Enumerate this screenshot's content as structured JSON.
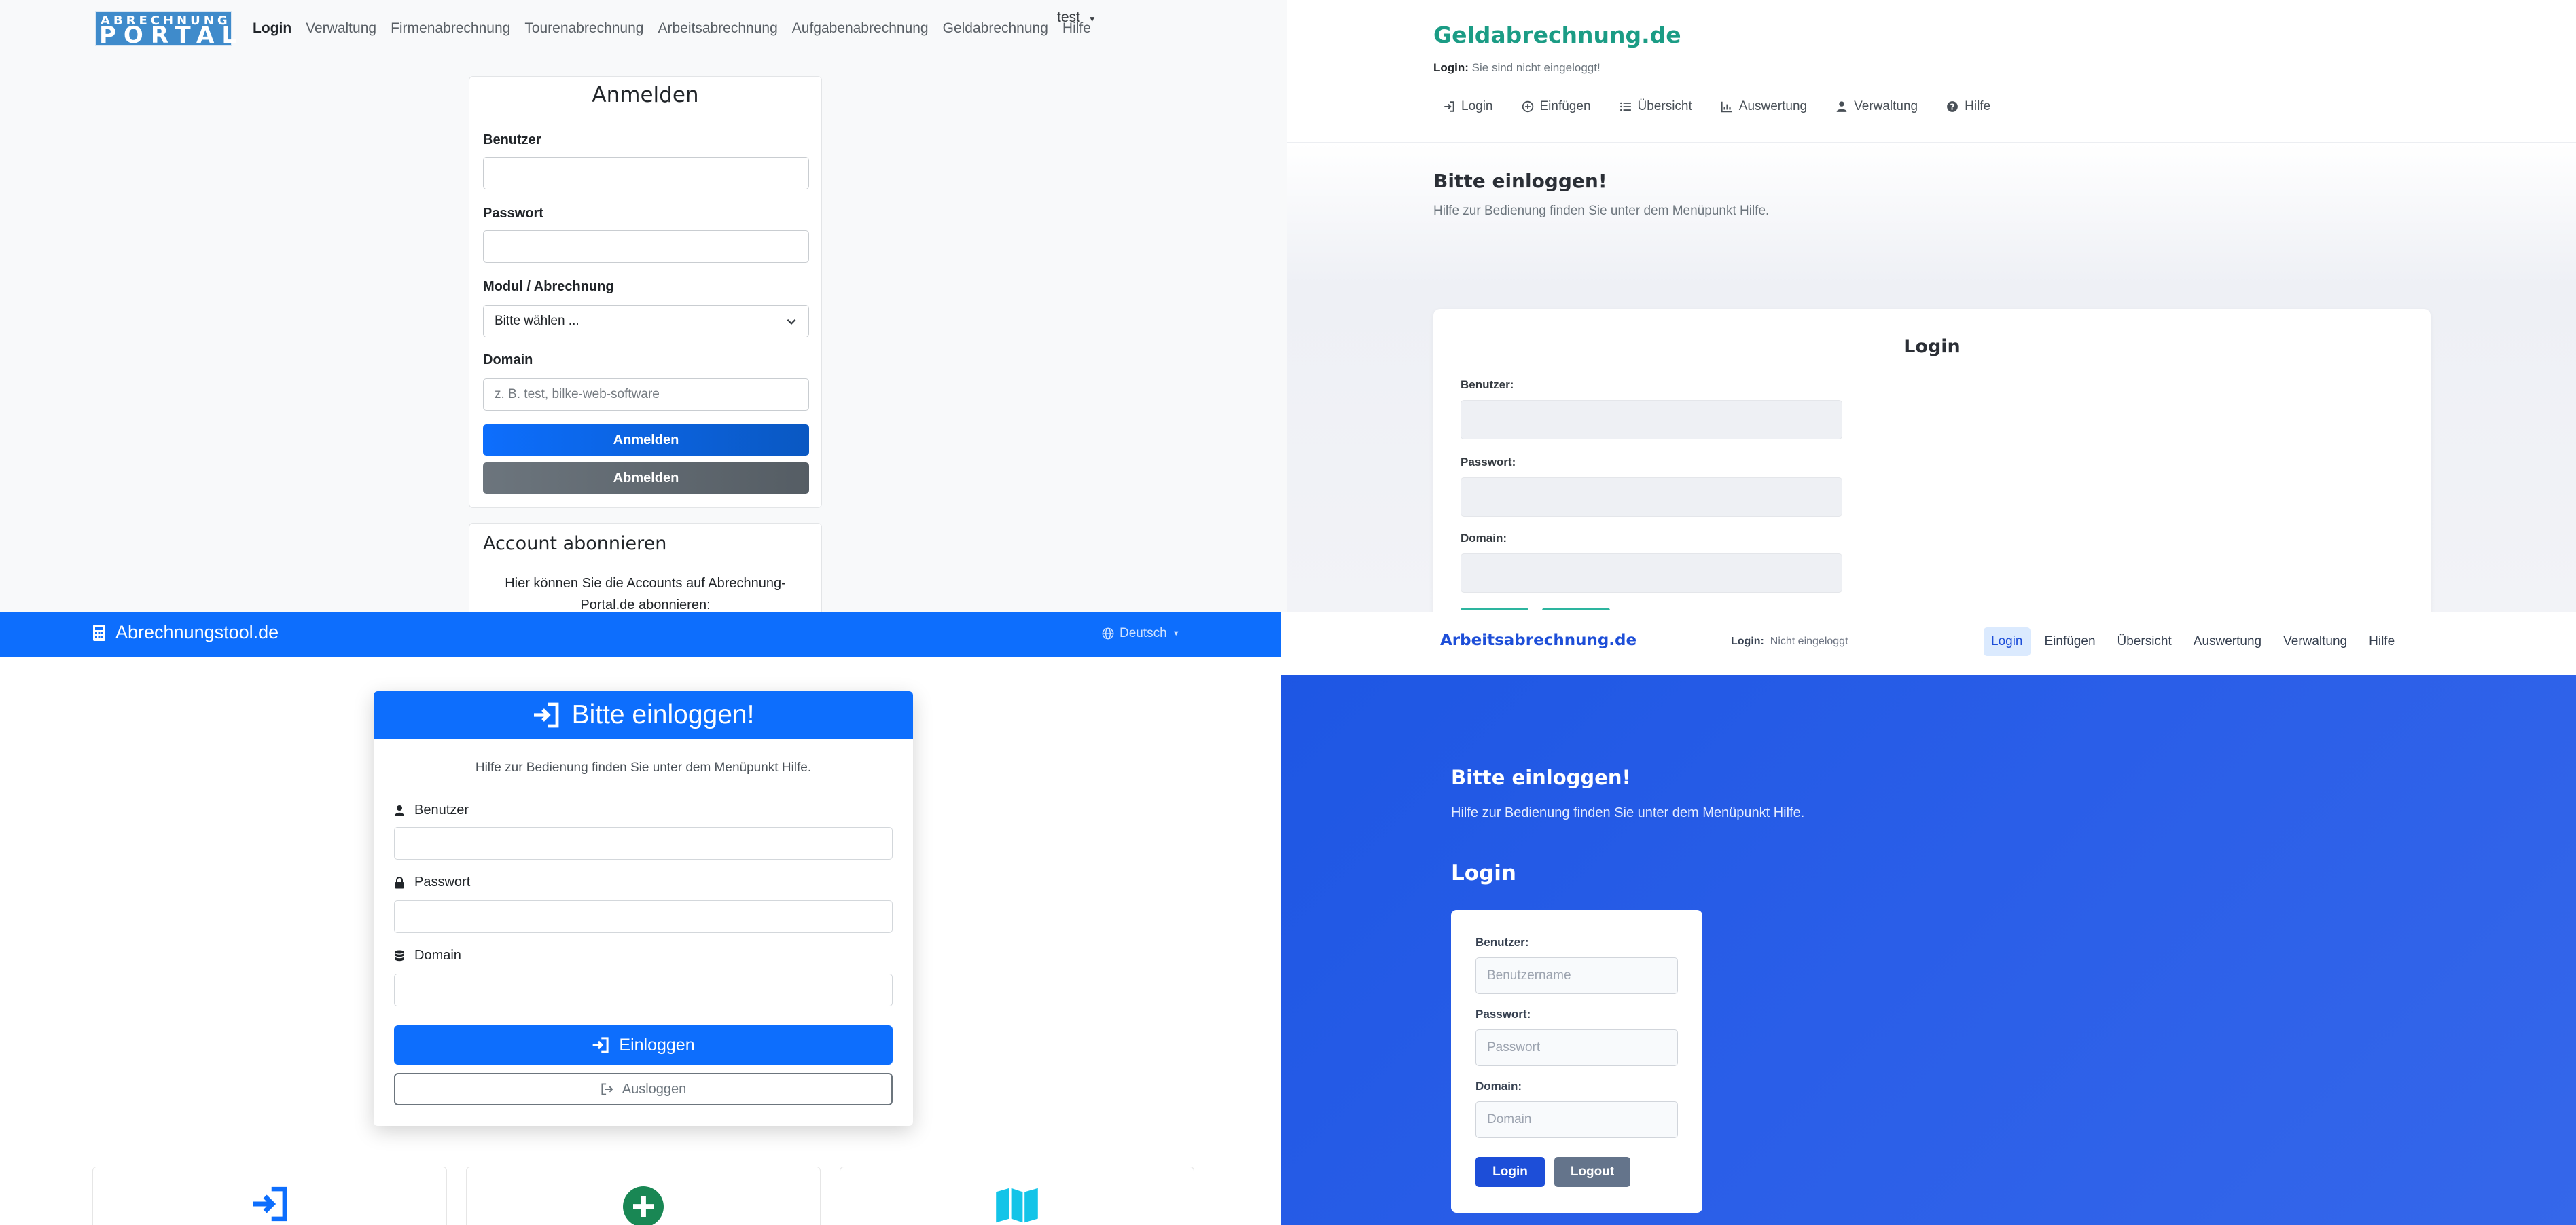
{
  "portal": {
    "logo_top": "ABRECHNUNG",
    "logo_bottom": "PORTAL",
    "nav": [
      "Login",
      "Verwaltung",
      "Firmenabrechnung",
      "Tourenabrechnung",
      "Arbeitsabrechnung",
      "Aufgabenabrechnung",
      "Geldabrechnung",
      "Hilfe"
    ],
    "user_menu": "test",
    "login_card": {
      "title": "Anmelden",
      "user_label": "Benutzer",
      "password_label": "Passwort",
      "module_label": "Modul / Abrechnung",
      "module_selected": "Bitte wählen ...",
      "domain_label": "Domain",
      "domain_placeholder": "z. B. test, bilke-web-software",
      "login_button": "Anmelden",
      "logout_button": "Abmelden"
    },
    "subscribe_card": {
      "title": "Account abonnieren",
      "text": "Hier können Sie die Accounts auf Abrechnung-Portal.de abonnieren:"
    }
  },
  "geld": {
    "brand": "Geldabrechnung.de",
    "status_label": "Login:",
    "status_text": "Sie sind nicht eingeloggt!",
    "nav": [
      "Login",
      "Einfügen",
      "Übersicht",
      "Auswertung",
      "Verwaltung",
      "Hilfe"
    ],
    "heading": "Bitte einloggen!",
    "subheading": "Hilfe zur Bedienung finden Sie unter dem Menüpunkt Hilfe.",
    "card": {
      "title": "Login",
      "user_label": "Benutzer:",
      "password_label": "Passwort:",
      "domain_label": "Domain:"
    }
  },
  "tool": {
    "brand": "Abrechnungstool.de",
    "language": "Deutsch",
    "card": {
      "title": "Bitte einloggen!",
      "help": "Hilfe zur Bedienung finden Sie unter dem Menüpunkt Hilfe.",
      "user_label": "Benutzer",
      "password_label": "Passwort",
      "domain_label": "Domain",
      "login_button": "Einloggen",
      "logout_button": "Ausloggen"
    }
  },
  "arbeit": {
    "brand": "Arbeitsabrechnung.de",
    "status_label": "Login:",
    "status_text": "Nicht eingeloggt",
    "nav": [
      "Login",
      "Einfügen",
      "Übersicht",
      "Auswertung",
      "Verwaltung",
      "Hilfe"
    ],
    "heading": "Bitte einloggen!",
    "subheading": "Hilfe zur Bedienung finden Sie unter dem Menüpunkt Hilfe.",
    "section_title": "Login",
    "card": {
      "user_label": "Benutzer:",
      "user_placeholder": "Benutzername",
      "password_label": "Passwort:",
      "password_placeholder": "Passwort",
      "domain_label": "Domain:",
      "domain_placeholder": "Domain",
      "login_button": "Login",
      "logout_button": "Logout"
    }
  },
  "colors": {
    "portal_primary": "#0d6efd",
    "geld_brand": "#1b9c85",
    "tool_primary": "#0d6efd",
    "arbeit_primary": "#1d4ed8"
  }
}
